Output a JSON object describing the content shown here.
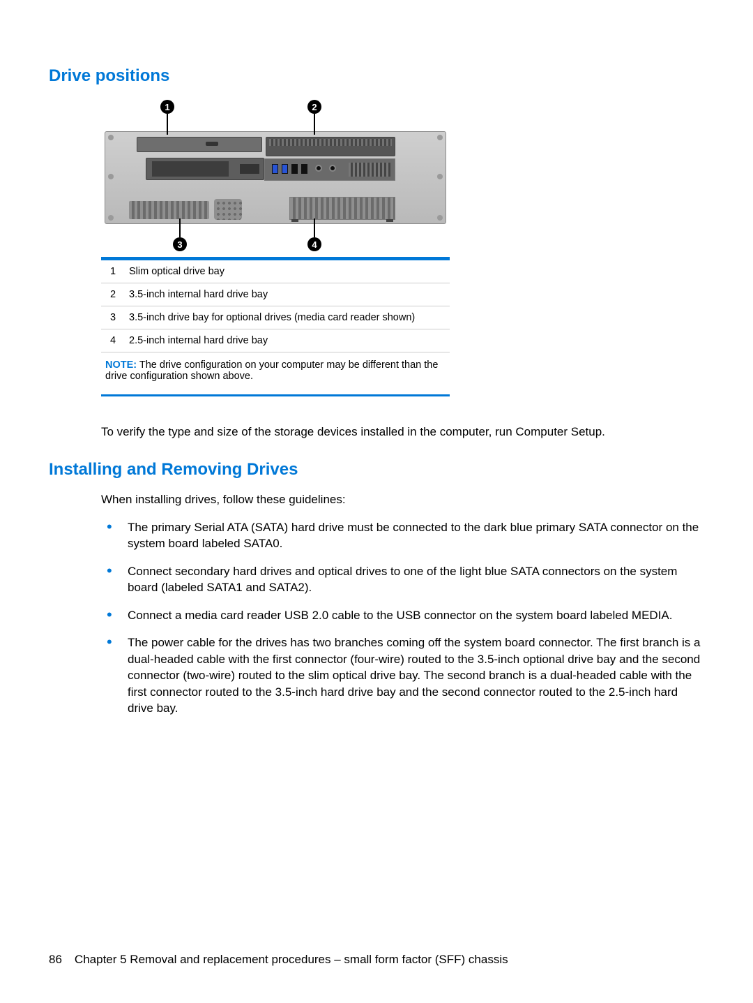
{
  "section1_title": "Drive positions",
  "section2_title": "Installing and Removing Drives",
  "callouts": {
    "c1": "1",
    "c2": "2",
    "c3": "3",
    "c4": "4"
  },
  "legend": [
    {
      "num": "1",
      "text": "Slim optical drive bay"
    },
    {
      "num": "2",
      "text": "3.5-inch internal hard drive bay"
    },
    {
      "num": "3",
      "text": "3.5-inch drive bay for optional drives (media card reader shown)"
    },
    {
      "num": "4",
      "text": "2.5-inch internal hard drive bay"
    }
  ],
  "note_label": "NOTE:",
  "note_text": "The drive configuration on your computer may be different than the drive configuration shown above.",
  "verify_text": "To verify the type and size of the storage devices installed in the computer, run Computer Setup.",
  "guidelines_intro": "When installing drives, follow these guidelines:",
  "guidelines": [
    "The primary Serial ATA (SATA) hard drive must be connected to the dark blue primary SATA connector on the system board labeled SATA0.",
    "Connect secondary hard drives and optical drives to one of the light blue SATA connectors on the system board (labeled SATA1 and SATA2).",
    "Connect a media card reader USB 2.0 cable to the USB connector on the system board labeled MEDIA.",
    "The power cable for the drives has two branches coming off the system board connector. The first branch is a dual-headed cable with the first connector (four-wire) routed to the 3.5-inch optional drive bay and the second connector (two-wire) routed to the slim optical drive bay. The second branch is a dual-headed cable with the first connector routed to the 3.5-inch hard drive bay and the second connector routed to the 2.5-inch hard drive bay."
  ],
  "footer": {
    "page_number": "86",
    "chapter": "Chapter 5   Removal and replacement procedures – small form factor (SFF) chassis"
  }
}
